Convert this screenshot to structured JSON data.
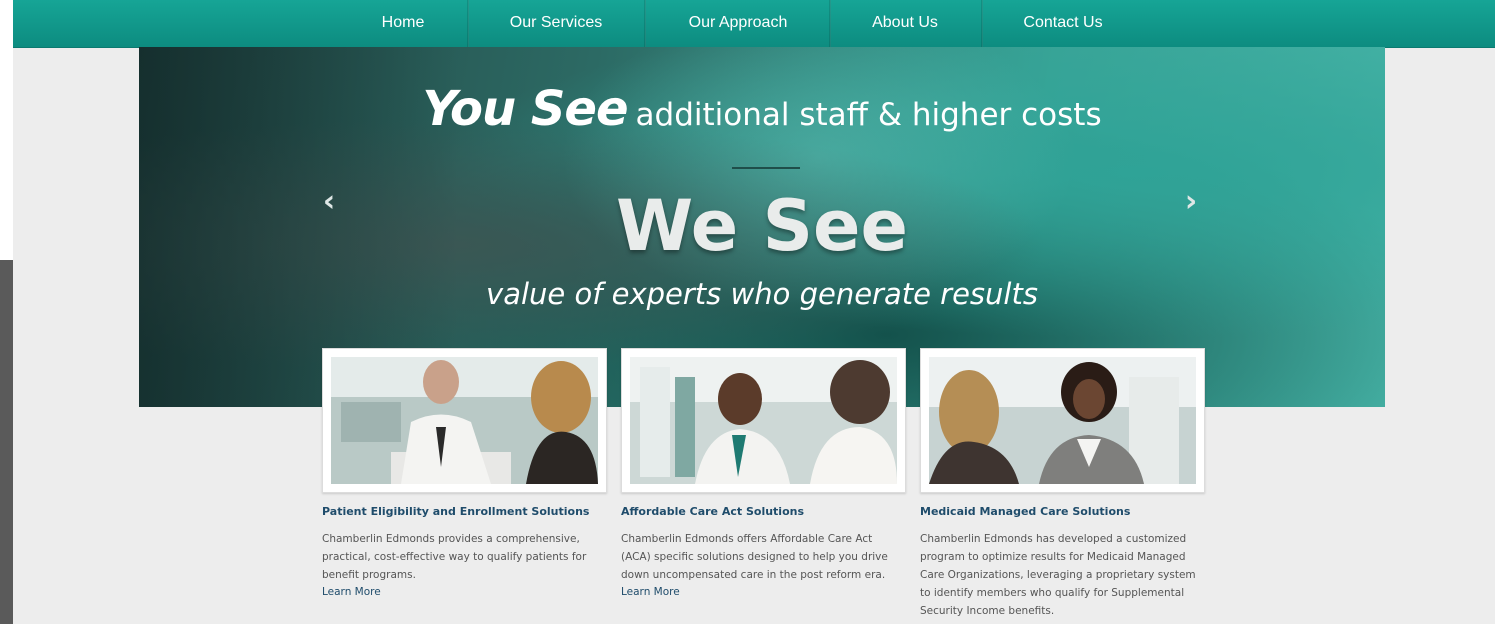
{
  "nav": {
    "items": [
      {
        "label": "Home"
      },
      {
        "label": "Our Services"
      },
      {
        "label": "Our Approach"
      },
      {
        "label": "About Us"
      },
      {
        "label": "Contact Us"
      }
    ]
  },
  "hero": {
    "line1_emphasis": "You See",
    "line1_rest": "additional staff & higher costs",
    "line2": "We See",
    "line3": "value of experts who generate results",
    "prev_arrow": "‹",
    "next_arrow": "›"
  },
  "cards": [
    {
      "title": "Patient Eligibility and Enrollment Solutions",
      "body": "Chamberlin Edmonds provides a comprehensive, practical, cost-effective way to qualify patients for benefit programs.",
      "link": "Learn More"
    },
    {
      "title": "Affordable Care Act Solutions",
      "body": "Chamberlin Edmonds offers Affordable Care Act (ACA) specific solutions designed to help you drive down uncompensated care in the post reform era.",
      "link": "Learn More"
    },
    {
      "title": "Medicaid Managed Care Solutions",
      "body": "Chamberlin Edmonds has developed a customized program to optimize results for Medicaid Managed Care Organizations, leveraging a proprietary system to identify members who qualify for Supplemental Security Income benefits.",
      "link": ""
    }
  ],
  "colors": {
    "nav": "#11998b",
    "hero_teal": "#2fa397",
    "title_blue": "#1f4c6b",
    "body_text": "#555555"
  }
}
